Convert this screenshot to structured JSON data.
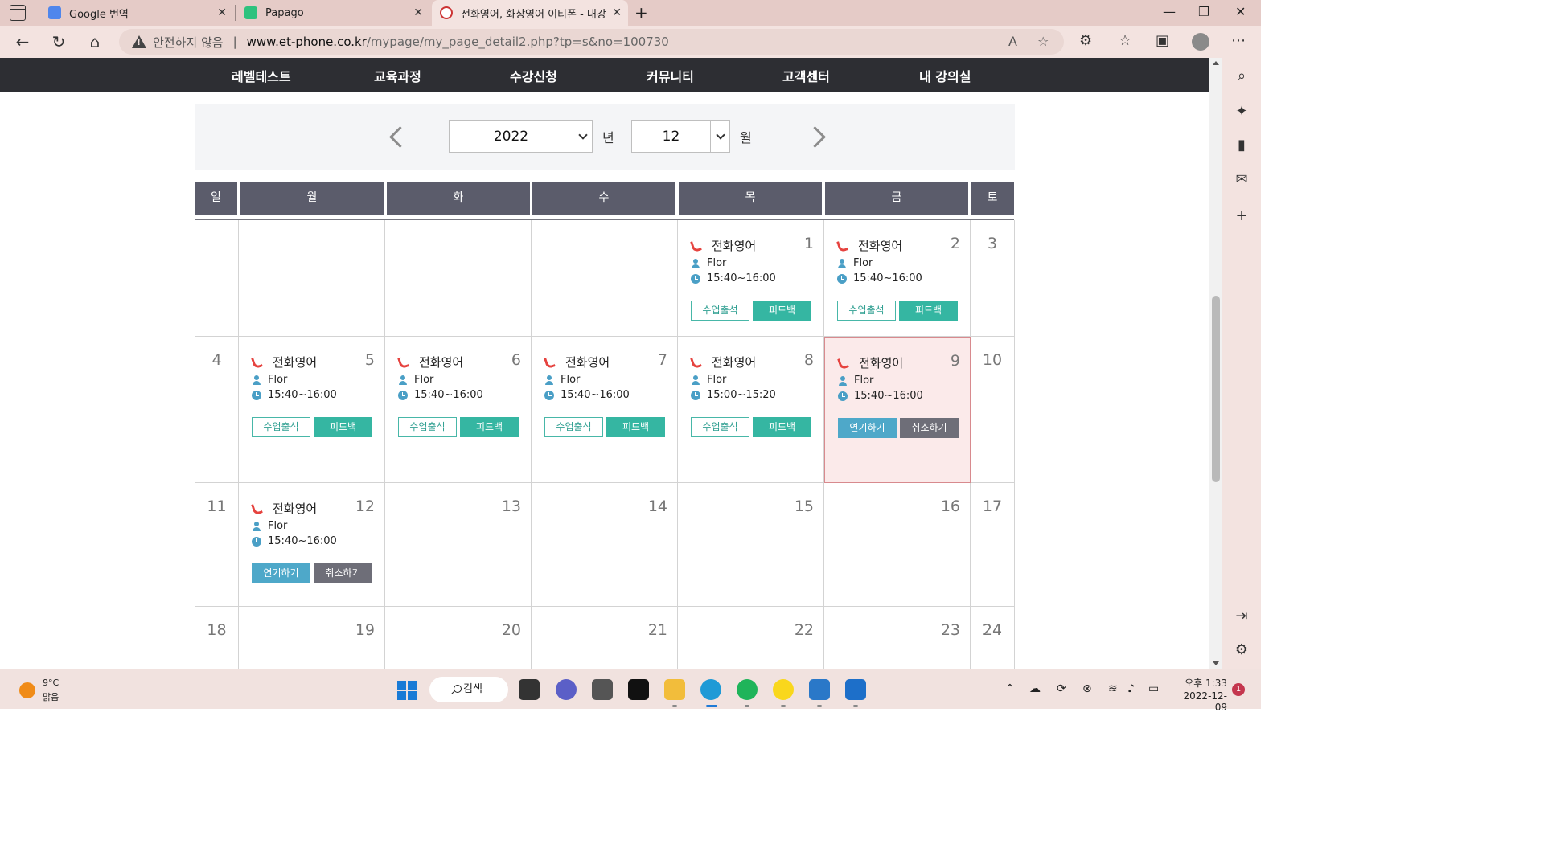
{
  "browser": {
    "tabs": [
      {
        "title": "Google 번역",
        "icon": "google-translate-icon"
      },
      {
        "title": "Papago",
        "icon": "papago-icon"
      },
      {
        "title": "전화영어, 화상영어 이티폰 - 내강",
        "icon": "etphone-icon"
      }
    ],
    "address": {
      "security_label": "안전하지 않음",
      "separator": "|",
      "host": "www.et-phone.co.kr",
      "path": "/mypage/my_page_detail2.php?tp=s&no=100730"
    }
  },
  "site_nav": {
    "items": [
      "레벨테스트",
      "교육과정",
      "수강신청",
      "커뮤니티",
      "고객센터",
      "내 강의실"
    ]
  },
  "date_picker": {
    "year": "2022",
    "year_unit": "년",
    "month": "12",
    "month_unit": "월"
  },
  "calendar": {
    "weekdays": [
      "일",
      "월",
      "화",
      "수",
      "목",
      "금",
      "토"
    ],
    "days": {
      "d1": "1",
      "d2": "2",
      "d3": "3",
      "d4": "4",
      "d5": "5",
      "d6": "6",
      "d7": "7",
      "d8": "8",
      "d9": "9",
      "d10": "10",
      "d11": "11",
      "d12": "12",
      "d13": "13",
      "d14": "14",
      "d15": "15",
      "d16": "16",
      "d17": "17",
      "d18": "18",
      "d19": "19",
      "d20": "20",
      "d21": "21",
      "d22": "22",
      "d23": "23",
      "d24": "24"
    },
    "lessons": {
      "d1": {
        "subject": "전화영어",
        "tutor": "Flor",
        "time": "15:40~16:00",
        "btn1": "수업출석",
        "btn2": "피드백"
      },
      "d2": {
        "subject": "전화영어",
        "tutor": "Flor",
        "time": "15:40~16:00",
        "btn1": "수업출석",
        "btn2": "피드백"
      },
      "d5": {
        "subject": "전화영어",
        "tutor": "Flor",
        "time": "15:40~16:00",
        "btn1": "수업출석",
        "btn2": "피드백"
      },
      "d6": {
        "subject": "전화영어",
        "tutor": "Flor",
        "time": "15:40~16:00",
        "btn1": "수업출석",
        "btn2": "피드백"
      },
      "d7": {
        "subject": "전화영어",
        "tutor": "Flor",
        "time": "15:40~16:00",
        "btn1": "수업출석",
        "btn2": "피드백"
      },
      "d8": {
        "subject": "전화영어",
        "tutor": "Flor",
        "time": "15:00~15:20",
        "btn1": "수업출석",
        "btn2": "피드백"
      },
      "d9": {
        "subject": "전화영어",
        "tutor": "Flor",
        "time": "15:40~16:00",
        "btn1": "연기하기",
        "btn2": "취소하기"
      },
      "d12": {
        "subject": "전화영어",
        "tutor": "Flor",
        "time": "15:40~16:00",
        "btn1": "연기하기",
        "btn2": "취소하기"
      }
    }
  },
  "taskbar": {
    "weather_temp": "9°C",
    "weather_desc": "맑음",
    "search_label": "검색",
    "time": "오후 1:33",
    "date": "2022-12-09",
    "notifications": "1"
  },
  "colors": {
    "nav_bg": "#2d2e33",
    "header_bg": "#5b5c6b",
    "teal": "#35b6a2",
    "blue": "#4ea8c9",
    "gray": "#6e6e78",
    "highlight_bg": "#fbeaea",
    "phone_red": "#e6433f"
  }
}
